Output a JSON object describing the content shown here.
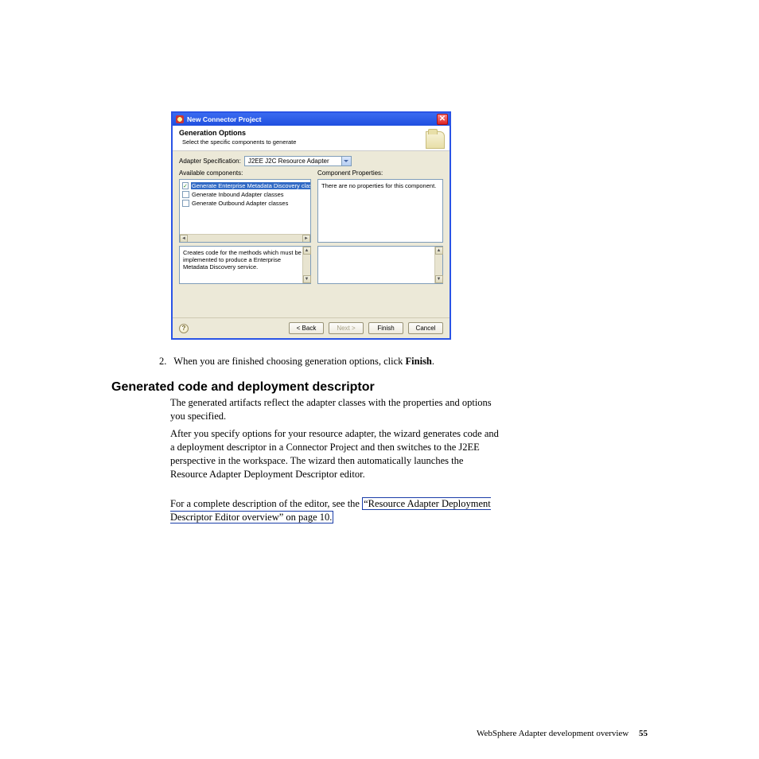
{
  "dialog": {
    "title": "New Connector Project",
    "banner_title": "Generation Options",
    "banner_sub": "Select the specific components to generate",
    "spec_label": "Adapter Specification:",
    "spec_value": "J2EE J2C Resource Adapter",
    "available_label": "Available components:",
    "props_label": "Component Properties:",
    "tree_items": {
      "i0": "Generate Enterprise Metadata Discovery classes",
      "i1": "Generate Inbound Adapter classes",
      "i2": "Generate Outbound Adapter classes"
    },
    "desc": "Creates code for the methods which must be implemented to produce a Enterprise Metadata Discovery service.",
    "props_empty": "There are no properties for this component.",
    "buttons": {
      "back": "< Back",
      "next": "Next >",
      "finish": "Finish",
      "cancel": "Cancel"
    }
  },
  "doc": {
    "step_num": "2.",
    "step_a": "When you are finished choosing generation options, click ",
    "step_b": "Finish",
    "step_c": ".",
    "h2": "Generated code and deployment descriptor",
    "p1": "The generated artifacts reflect the adapter classes with the properties and options you specified.",
    "p2": "After you specify options for your resource adapter, the wizard generates code and a deployment descriptor in a Connector Project and then switches to the J2EE perspective in the workspace. The wizard then automatically launches the Resource Adapter Deployment Descriptor editor.",
    "p3a": "For a complete description of the editor, see the ",
    "link": "“Resource Adapter Deployment Descriptor Editor overview” on page 10.",
    "footer_text": "WebSphere Adapter development overview",
    "page_no": "55"
  }
}
